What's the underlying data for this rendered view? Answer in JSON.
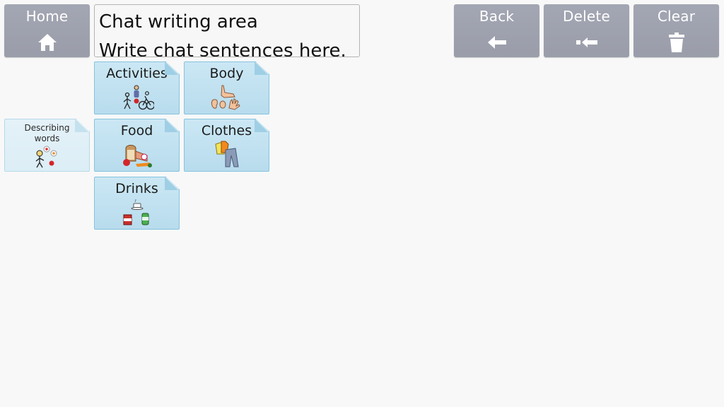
{
  "toolbar": {
    "home_label": "Home",
    "back_label": "Back",
    "delete_label": "Delete",
    "clear_label": "Clear",
    "icons": {
      "home": "home-icon",
      "back": "arrow-left-icon",
      "delete": "backspace-icon",
      "clear": "trash-icon"
    },
    "button_color": "#9fa2ae",
    "button_text_color": "#ffffff"
  },
  "chat": {
    "line1": "Chat writing area",
    "line2": "Write chat sentences here."
  },
  "categories": [
    {
      "label": "Activities",
      "icon": "activities-symbol-icon"
    },
    {
      "label": "Body",
      "icon": "body-parts-symbol-icon"
    },
    {
      "label": "Describing words",
      "icon": "describing-symbol-icon"
    },
    {
      "label": "Food",
      "icon": "food-symbol-icon"
    },
    {
      "label": "Clothes",
      "icon": "clothes-symbol-icon"
    },
    {
      "label": "Drinks",
      "icon": "drinks-symbol-icon"
    }
  ],
  "colors": {
    "tile_fill": "#c3e3f2",
    "tile_border": "#86c3de",
    "tile_faded_fill": "#e1f0f7",
    "background": "#f8f8f8"
  }
}
